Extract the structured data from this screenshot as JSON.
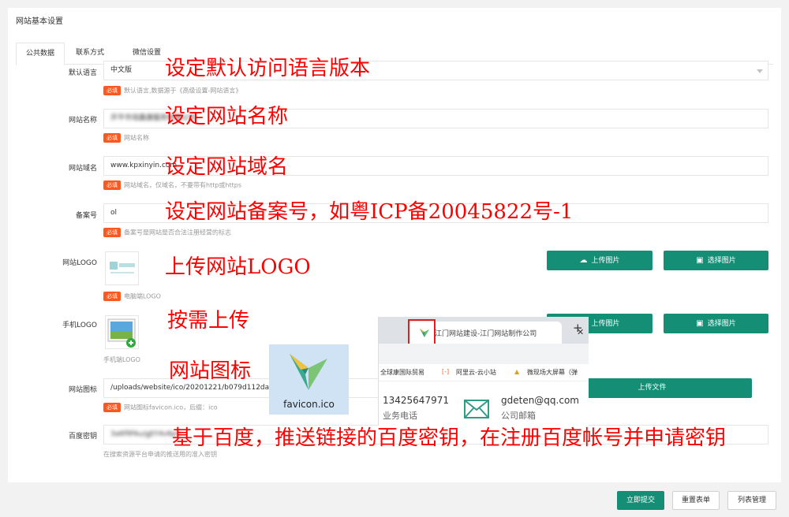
{
  "panel": {
    "title": "网站基本设置"
  },
  "tabs": [
    {
      "label": "公共数据",
      "active": true
    },
    {
      "label": "联系方式",
      "active": false
    },
    {
      "label": "微信设置",
      "active": false
    }
  ],
  "fields": {
    "language": {
      "label": "默认语言",
      "value": "中文版",
      "hint": "默认语言,数据源于《高级设置-网站语言》"
    },
    "site_name": {
      "label": "网站名称",
      "value": "开平市培鑫康服务有限公司",
      "hint": "网站名称"
    },
    "domain": {
      "label": "网站域名",
      "value": "www.kpxinyin.com",
      "hint": "网站域名，仅域名，不要带有http或https"
    },
    "icp": {
      "label": "备案号",
      "value": "ol",
      "hint": "备案号是网站是否合法注册经营的标志"
    },
    "logo": {
      "label": "网站LOGO",
      "hint": "电脑端LOGO"
    },
    "mobile_logo": {
      "label": "手机LOGO",
      "hint": "手机端LOGO"
    },
    "favicon": {
      "label": "网站图标",
      "value": "/uploads/website/ico/20201221/b079d112da701aa",
      "hint": "网站图标favicon.ico，后缀：ico"
    },
    "baidu_key": {
      "label": "百度密钥",
      "value": "3a6f9f4u/gJtY4v6pV",
      "hint": "在搜索资源平台申请的推送用的准入密钥"
    }
  },
  "required_badge": "必填",
  "buttons": {
    "upload_image": "上传图片",
    "choose_image": "选择图片",
    "upload_file": "上传文件",
    "submit": "立即提交",
    "reset": "重置表单",
    "list_manage": "列表管理"
  },
  "annotations": {
    "language": "设定默认访问语言版本",
    "site_name": "设定网站名称",
    "domain": "设定网站域名",
    "icp": "设定网站备案号，如粤ICP备20045822号-1",
    "logo": "上传网站LOGO",
    "mobile_logo": "按需上传",
    "favicon": "网站图标",
    "baidu_key": "基于百度，推送链接的百度密钥，在注册百度帐号并申请密钥"
  },
  "favicon_preview": {
    "label": "favicon.ico"
  },
  "browser_overlay": {
    "tab_title": "江门网站建设-江门网站制作公司",
    "bookmarks": [
      "全球康国际贸易",
      "阿里云-云小站",
      "微现场大屏幕（弹"
    ],
    "phone": "13425647971",
    "phone_label": "业务电话",
    "email": "gdeten@qq.com",
    "email_label": "公司邮箱"
  },
  "colors": {
    "accent": "#148f76",
    "required": "#ff5722",
    "annotation": "#ff0000"
  }
}
